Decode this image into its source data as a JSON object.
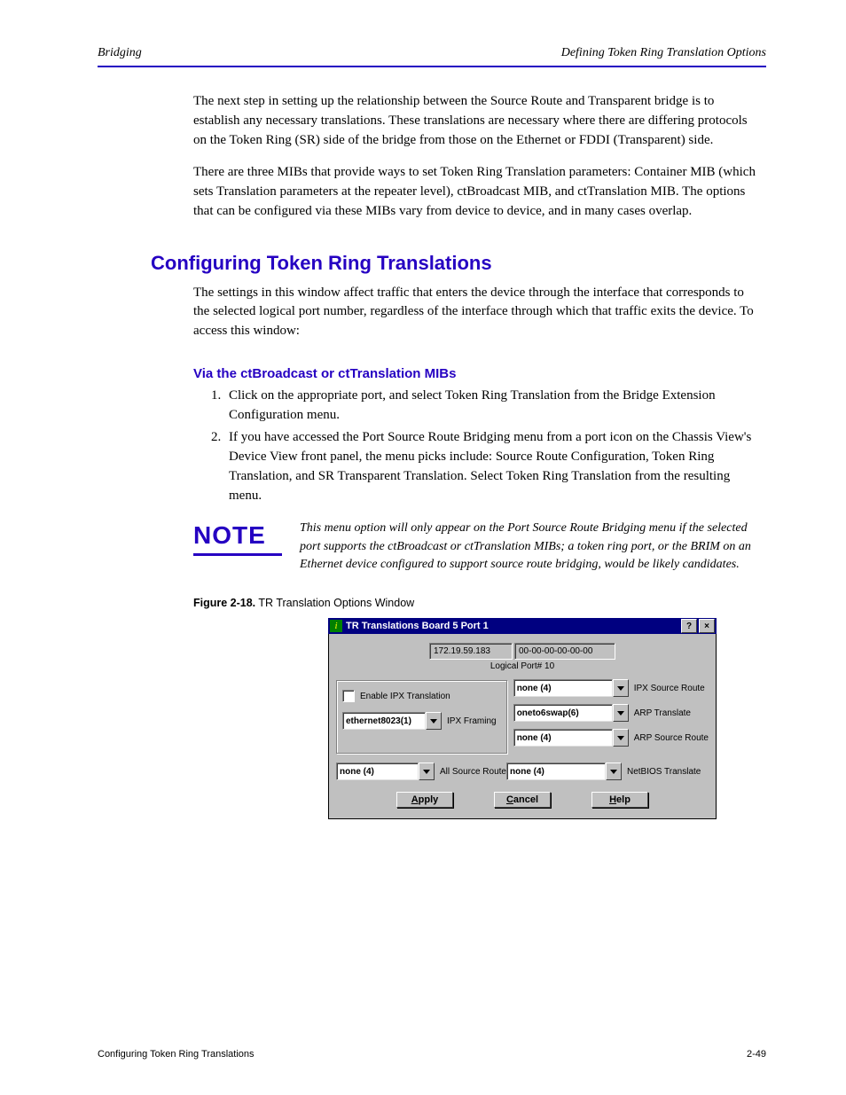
{
  "header": {
    "left": "Bridging",
    "right": "Defining Token Ring Translation Options"
  },
  "intro_paragraphs": [
    "The next step in setting up the relationship between the Source Route and Transparent bridge is to establish any necessary translations. These translations are necessary where there are differing protocols on the Token Ring (SR) side of the bridge from those on the Ethernet or FDDI (Transparent) side.",
    "There are three MIBs that provide ways to set Token Ring Translation parameters: Container MIB (which sets Translation parameters at the repeater level), ctBroadcast MIB, and ctTranslation MIB. The options that can be configured via these MIBs vary from device to device, and in many cases overlap."
  ],
  "sec_title": "Configuring Token Ring Translations",
  "sec_para": "The settings in this window affect traffic that enters the device through the interface that corresponds to the selected logical port number, regardless of the interface through which that traffic exits the device. To access this window:",
  "steps_title": "Via the ctBroadcast or ctTranslation MIBs",
  "steps": [
    "Click on the appropriate port, and select Token Ring Translation from the Bridge Extension Configuration menu.",
    "If you have accessed the Port Source Route Bridging menu from a port icon on the Chassis View's Device View front panel, the menu picks include: Source Route Configuration, Token Ring Translation, and SR Transparent Translation. Select Token Ring Translation from the resulting menu."
  ],
  "note_title": "NOTE",
  "note_text": "This menu option will only appear on the Port Source Route Bridging menu if the selected port supports the ctBroadcast or ctTranslation MIBs; a token ring port, or the BRIM on an Ethernet device configured to support source route bridging, would be likely candidates.",
  "caption": {
    "label": "Figure 2-18.",
    "text": "TR Translation Options Window"
  },
  "dialog": {
    "title": "TR Translations Board 5 Port 1",
    "help_btn": "?",
    "close_btn": "×",
    "ip": "172.19.59.183",
    "mac": "00-00-00-00-00-00",
    "logical": "Logical Port#   10",
    "enable_ipx_label": "Enable IPX Translation",
    "ipx_framing_label": "IPX Framing",
    "ipx_framing_value": "ethernet8023(1)",
    "all_source_label": "All Source Route",
    "all_source_value": "none (4)",
    "ipx_source_label": "IPX Source Route",
    "ipx_source_value": "none (4)",
    "arp_translate_label": "ARP Translate",
    "arp_translate_value": "oneto6swap(6)",
    "arp_source_label": "ARP Source Route",
    "arp_source_value": "none (4)",
    "netbios_label": "NetBIOS  Translate",
    "netbios_value": "none (4)",
    "apply": "pply",
    "apply_u": "A",
    "cancel": "ancel",
    "cancel_u": "C",
    "helpb": "elp",
    "help_u": "H"
  },
  "footer": {
    "left": "Configuring Token Ring Translations",
    "right": "2-49"
  }
}
